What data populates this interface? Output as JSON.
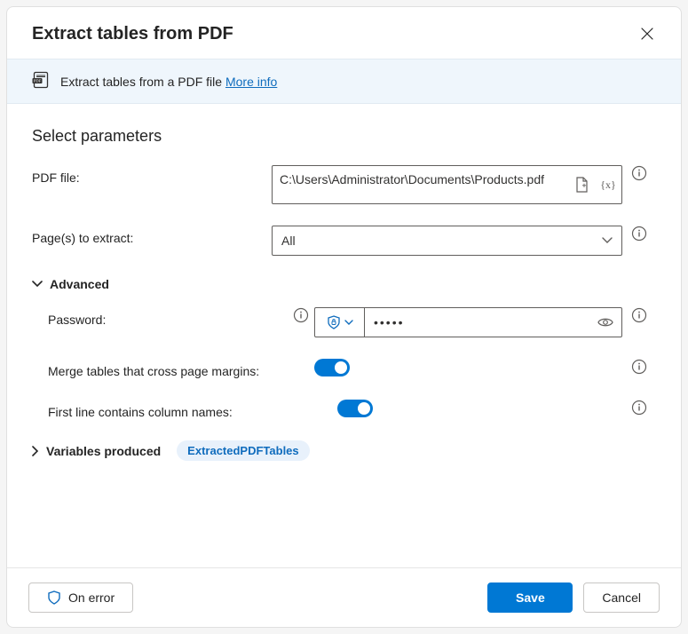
{
  "header": {
    "title": "Extract tables from PDF"
  },
  "infobar": {
    "icon": "pdf-icon",
    "text": "Extract tables from a PDF file ",
    "link": "More info"
  },
  "sections": {
    "params_title": "Select parameters",
    "advanced_label": "Advanced",
    "variables_label": "Variables produced"
  },
  "fields": {
    "pdf_file": {
      "label": "PDF file:",
      "value": "C:\\Users\\Administrator\\Documents\\Products.pdf"
    },
    "pages": {
      "label": "Page(s) to extract:",
      "value": "All"
    },
    "password": {
      "label": "Password:",
      "masked": "•••••"
    },
    "merge": {
      "label": "Merge tables that cross page margins:",
      "on": true
    },
    "firstline": {
      "label": "First line contains column names:",
      "on": true
    }
  },
  "variables": {
    "produced": "ExtractedPDFTables"
  },
  "footer": {
    "on_error": "On error",
    "save": "Save",
    "cancel": "Cancel"
  }
}
